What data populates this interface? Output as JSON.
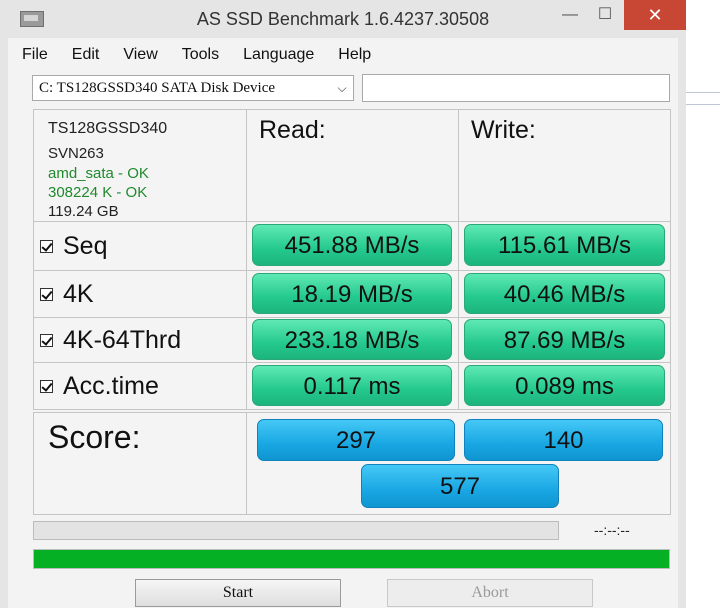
{
  "window": {
    "title": "AS SSD Benchmark 1.6.4237.30508",
    "minimize": "—",
    "maximize": "☐",
    "close": "✕"
  },
  "menu": [
    "File",
    "Edit",
    "View",
    "Tools",
    "Language",
    "Help"
  ],
  "drive": {
    "selected": "C:  TS128GSSD340 SATA Disk Device",
    "arrow": "⌵",
    "text_value": ""
  },
  "device_info": {
    "model": "TS128GSSD340",
    "firmware": "SVN263",
    "driver": "amd_sata - OK",
    "alignment": "308224 K - OK",
    "capacity": "119.24 GB"
  },
  "headers": {
    "read": "Read:",
    "write": "Write:"
  },
  "tests": [
    {
      "label": "Seq",
      "checked": true,
      "read": "451.88 MB/s",
      "write": "115.61 MB/s"
    },
    {
      "label": "4K",
      "checked": true,
      "read": "18.19 MB/s",
      "write": "40.46 MB/s"
    },
    {
      "label": "4K-64Thrd",
      "checked": true,
      "read": "233.18 MB/s",
      "write": "87.69 MB/s"
    },
    {
      "label": "Acc.time",
      "checked": true,
      "read": "0.117 ms",
      "write": "0.089 ms"
    }
  ],
  "score": {
    "label": "Score:",
    "read": "297",
    "write": "140",
    "total": "577"
  },
  "status": {
    "time": "--:--:--",
    "progress_fraction": 1.0
  },
  "buttons": {
    "start": "Start",
    "abort": "Abort"
  },
  "colors": {
    "result_green": "#24c98d",
    "score_blue": "#19a7e3",
    "progress_green": "#06b025",
    "ok_text": "#1f8a2c"
  }
}
